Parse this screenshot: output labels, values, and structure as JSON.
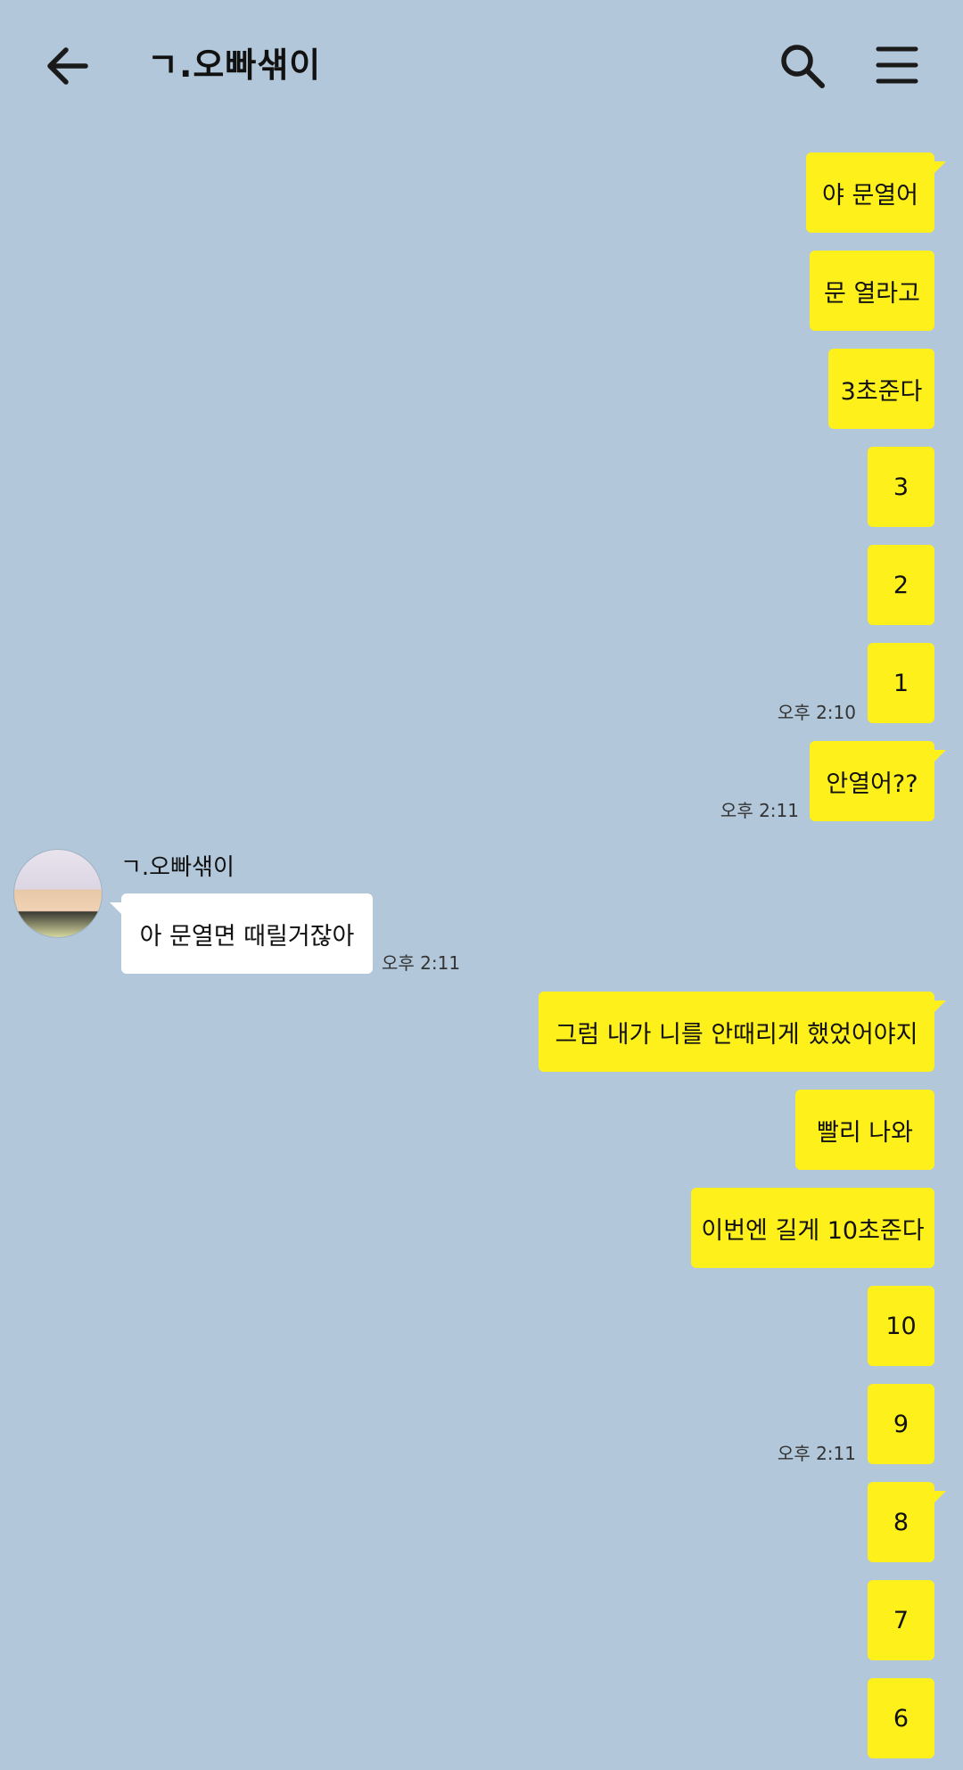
{
  "header": {
    "title": "ㄱ.오빠샊이",
    "back_icon": "arrow-left-icon",
    "search_icon": "search-icon",
    "menu_icon": "hamburger-menu-icon"
  },
  "colors": {
    "background": "#B2C7DA",
    "sent_bubble": "#FEF01B",
    "received_bubble": "#FFFFFF"
  },
  "messages": [
    {
      "direction": "sent",
      "text": "야 문열어",
      "time": ""
    },
    {
      "direction": "sent",
      "text": "문 열라고",
      "time": ""
    },
    {
      "direction": "sent",
      "text": "3초준다",
      "time": ""
    },
    {
      "direction": "sent",
      "text": "3",
      "time": ""
    },
    {
      "direction": "sent",
      "text": "2",
      "time": ""
    },
    {
      "direction": "sent",
      "text": "1",
      "time": "오후 2:10"
    },
    {
      "direction": "sent",
      "text": "안열어??",
      "time": "오후 2:11"
    },
    {
      "direction": "received",
      "sender": "ㄱ.오빠샊이",
      "text": "아 문열면 때릴거잖아",
      "time": "오후 2:11"
    },
    {
      "direction": "sent",
      "text": "그럼 내가 니를 안때리게 했었어야지",
      "time": ""
    },
    {
      "direction": "sent",
      "text": "빨리 나와",
      "time": ""
    },
    {
      "direction": "sent",
      "text": "이번엔 길게 10초준다",
      "time": ""
    },
    {
      "direction": "sent",
      "text": "10",
      "time": ""
    },
    {
      "direction": "sent",
      "text": "9",
      "time": "오후 2:11"
    },
    {
      "direction": "sent",
      "text": "8",
      "time": ""
    },
    {
      "direction": "sent",
      "text": "7",
      "time": ""
    },
    {
      "direction": "sent",
      "text": "6",
      "time": ""
    }
  ]
}
